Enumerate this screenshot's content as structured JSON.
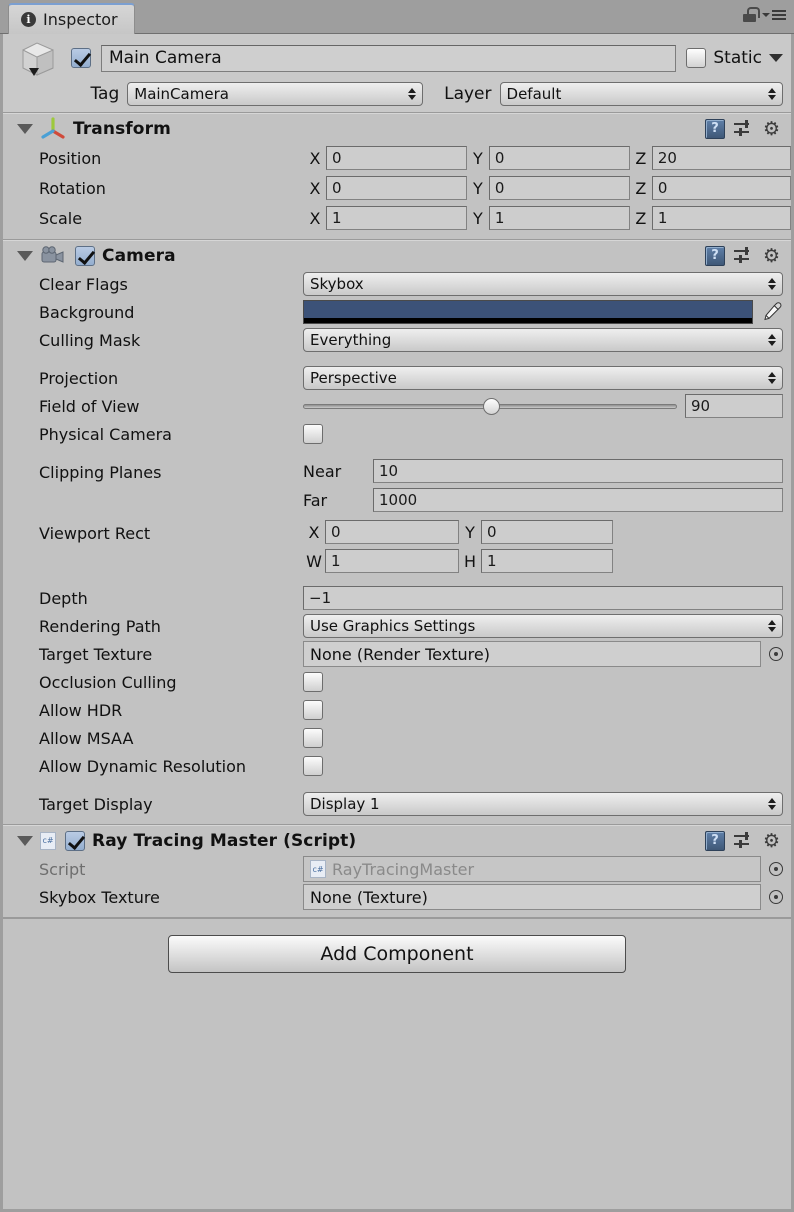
{
  "window": {
    "tab_label": "Inspector",
    "tab_icon": "info-icon",
    "lock_icon": "lock-icon",
    "menu_icon": "hamburger-menu-icon"
  },
  "gameobject": {
    "icon": "cube-icon",
    "enabled": true,
    "name": "Main Camera",
    "static_label": "Static",
    "static_checked": false,
    "tag_label": "Tag",
    "tag_value": "MainCamera",
    "layer_label": "Layer",
    "layer_value": "Default"
  },
  "components": [
    {
      "id": "transform",
      "title": "Transform",
      "icon": "transform-gizmo-icon",
      "expanded": true,
      "has_enable_toggle": false,
      "header_icons": [
        "help-icon",
        "preset-icon",
        "gear-icon"
      ],
      "vectors": [
        {
          "label": "Position",
          "x": "0",
          "y": "0",
          "z": "20"
        },
        {
          "label": "Rotation",
          "x": "0",
          "y": "0",
          "z": "0"
        },
        {
          "label": "Scale",
          "x": "1",
          "y": "1",
          "z": "1"
        }
      ],
      "axis_labels": {
        "x": "X",
        "y": "Y",
        "z": "Z"
      }
    },
    {
      "id": "camera",
      "title": "Camera",
      "icon": "camera-icon",
      "expanded": true,
      "has_enable_toggle": true,
      "enabled": true,
      "header_icons": [
        "help-icon",
        "preset-icon",
        "gear-icon"
      ],
      "fields": {
        "clear_flags_label": "Clear Flags",
        "clear_flags_value": "Skybox",
        "background_label": "Background",
        "background_color": "#3c5278",
        "eyedropper_icon": "eyedropper-icon",
        "culling_mask_label": "Culling Mask",
        "culling_mask_value": "Everything",
        "projection_label": "Projection",
        "projection_value": "Perspective",
        "fov_label": "Field of View",
        "fov_value": "90",
        "fov_slider_percent": 48,
        "physical_camera_label": "Physical Camera",
        "physical_camera_checked": false,
        "clipping_planes_label": "Clipping Planes",
        "near_label": "Near",
        "near_value": "10",
        "far_label": "Far",
        "far_value": "1000",
        "viewport_rect_label": "Viewport Rect",
        "viewport_x_label": "X",
        "viewport_x": "0",
        "viewport_y_label": "Y",
        "viewport_y": "0",
        "viewport_w_label": "W",
        "viewport_w": "1",
        "viewport_h_label": "H",
        "viewport_h": "1",
        "depth_label": "Depth",
        "depth_value": "−1",
        "rendering_path_label": "Rendering Path",
        "rendering_path_value": "Use Graphics Settings",
        "target_texture_label": "Target Texture",
        "target_texture_value": "None (Render Texture)",
        "occlusion_culling_label": "Occlusion Culling",
        "occlusion_culling_checked": false,
        "allow_hdr_label": "Allow HDR",
        "allow_hdr_checked": false,
        "allow_msaa_label": "Allow MSAA",
        "allow_msaa_checked": false,
        "allow_dynres_label": "Allow Dynamic Resolution",
        "allow_dynres_checked": false,
        "target_display_label": "Target Display",
        "target_display_value": "Display 1"
      }
    },
    {
      "id": "ray-tracing-master",
      "title": "Ray Tracing Master (Script)",
      "icon": "csharp-script-icon",
      "expanded": true,
      "has_enable_toggle": true,
      "enabled": true,
      "header_icons": [
        "help-icon",
        "preset-icon",
        "gear-icon"
      ],
      "fields": {
        "script_label": "Script",
        "script_value": "RayTracingMaster",
        "skybox_texture_label": "Skybox Texture",
        "skybox_texture_value": "None (Texture)"
      }
    }
  ],
  "footer": {
    "add_component_label": "Add Component"
  }
}
